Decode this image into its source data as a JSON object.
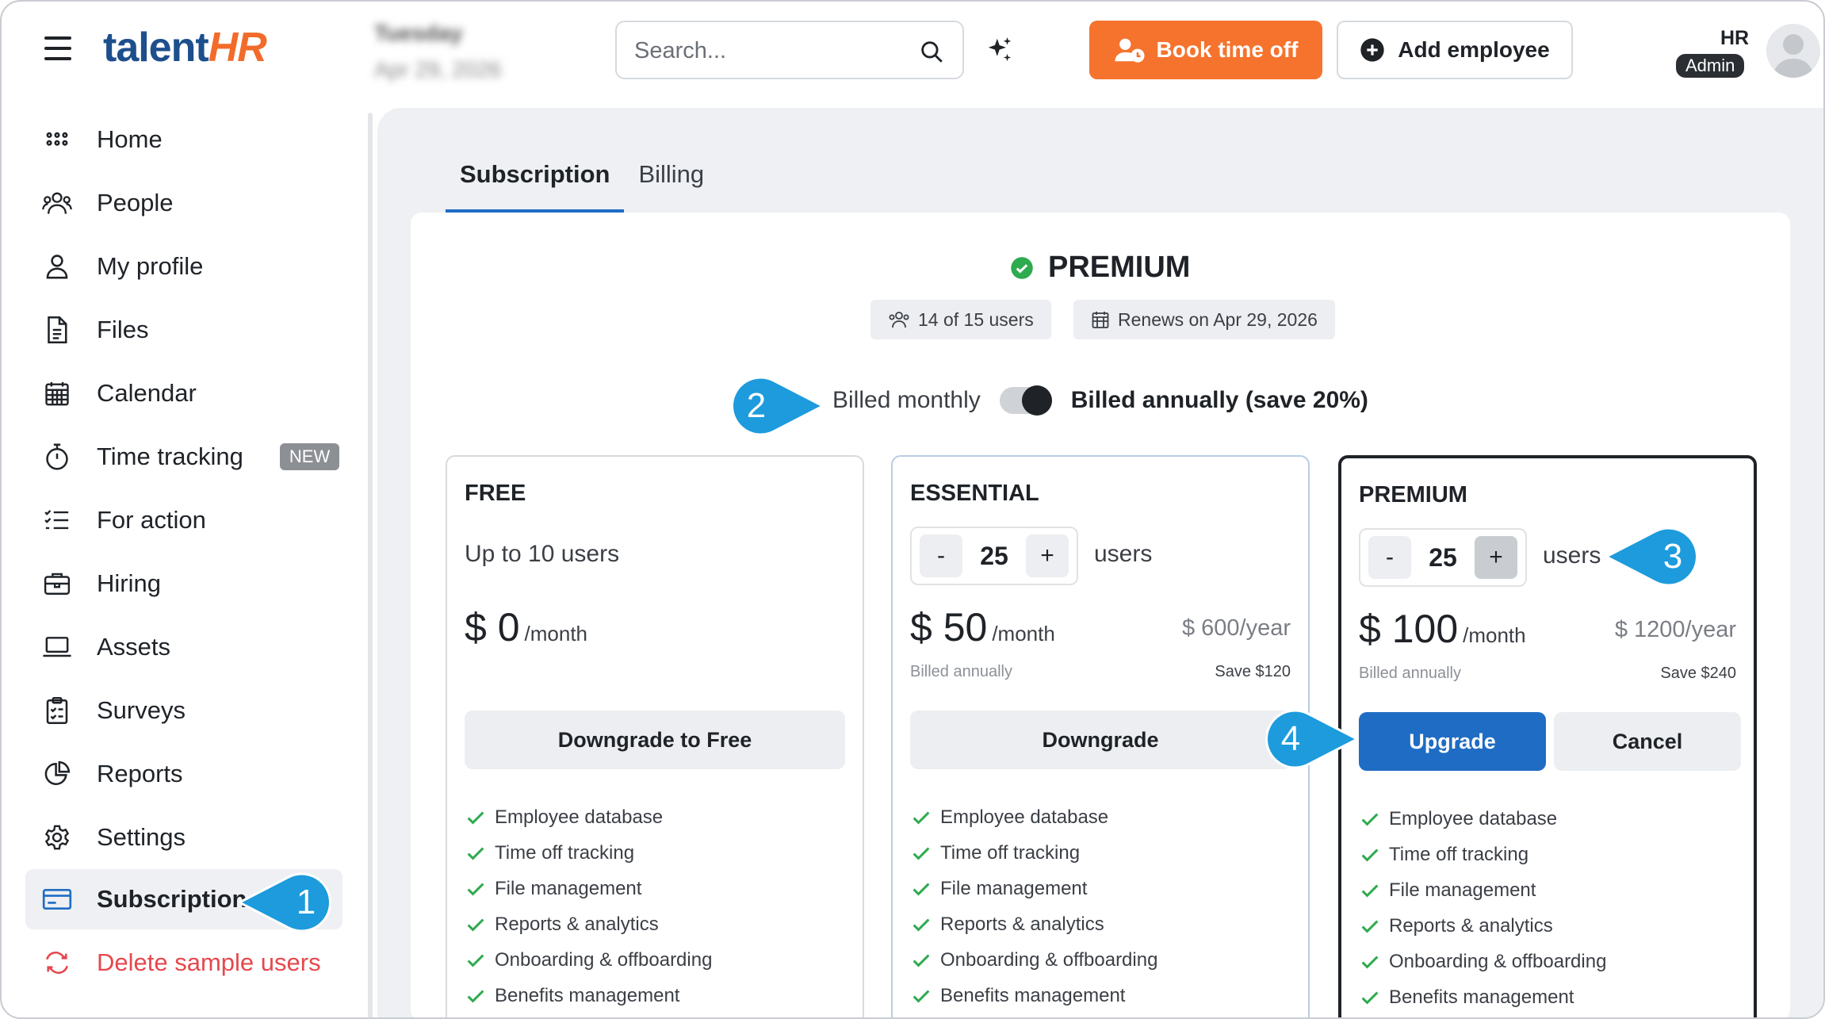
{
  "header": {
    "logo_part1": "talent",
    "logo_part2": "HR",
    "date_day": "Tuesday",
    "date_full": "Apr 29, 2026",
    "search_placeholder": "Search...",
    "book_time_off": "Book time off",
    "add_employee": "Add employee",
    "user_role": "HR",
    "user_badge": "Admin"
  },
  "sidebar": {
    "items": [
      {
        "label": "Home",
        "icon": "grid-icon"
      },
      {
        "label": "People",
        "icon": "people-icon"
      },
      {
        "label": "My profile",
        "icon": "user-icon"
      },
      {
        "label": "Files",
        "icon": "file-icon"
      },
      {
        "label": "Calendar",
        "icon": "calendar-icon"
      },
      {
        "label": "Time tracking",
        "icon": "stopwatch-icon",
        "badge": "NEW"
      },
      {
        "label": "For action",
        "icon": "checklist-icon"
      },
      {
        "label": "Hiring",
        "icon": "briefcase-icon"
      },
      {
        "label": "Assets",
        "icon": "laptop-icon"
      },
      {
        "label": "Surveys",
        "icon": "clipboard-icon"
      },
      {
        "label": "Reports",
        "icon": "pie-chart-icon"
      },
      {
        "label": "Settings",
        "icon": "gear-icon"
      },
      {
        "label": "Subscription",
        "icon": "credit-card-icon",
        "active": true
      },
      {
        "label": "Delete sample users",
        "icon": "refresh-icon",
        "danger": true
      }
    ]
  },
  "tabs": [
    {
      "label": "Subscription",
      "active": true
    },
    {
      "label": "Billing",
      "active": false
    }
  ],
  "current_plan": {
    "name": "PREMIUM",
    "users": "14 of 15 users",
    "renews": "Renews on Apr 29, 2026"
  },
  "billing_toggle": {
    "monthly_label": "Billed monthly",
    "annually_label": "Billed annually (save 20%)",
    "selected": "annually"
  },
  "plans": [
    {
      "name": "FREE",
      "users_text": "Up to 10 users",
      "price": "$ 0",
      "per": "/month",
      "button": "Downgrade to Free"
    },
    {
      "name": "ESSENTIAL",
      "users_count": "25",
      "users_unit": "users",
      "price": "$ 50",
      "per": "/month",
      "yearly": "$ 600/year",
      "billed_note": "Billed annually",
      "save_note": "Save $120",
      "button": "Downgrade"
    },
    {
      "name": "PREMIUM",
      "users_count": "25",
      "users_unit": "users",
      "price": "$ 100",
      "per": "/month",
      "yearly": "$ 1200/year",
      "billed_note": "Billed annually",
      "save_note": "Save $240",
      "button_primary": "Upgrade",
      "button_secondary": "Cancel"
    }
  ],
  "stepper": {
    "minus": "-",
    "plus": "+"
  },
  "features": [
    "Employee database",
    "Time off tracking",
    "File management",
    "Reports & analytics",
    "Onboarding & offboarding",
    "Benefits management"
  ],
  "callouts": [
    "1",
    "2",
    "3",
    "4"
  ],
  "colors": {
    "accent_orange": "#f5732d",
    "primary_blue": "#1e6cc4",
    "callout_blue": "#1d9bdc",
    "check_green": "#2eaa4f",
    "danger_red": "#e5484d"
  }
}
